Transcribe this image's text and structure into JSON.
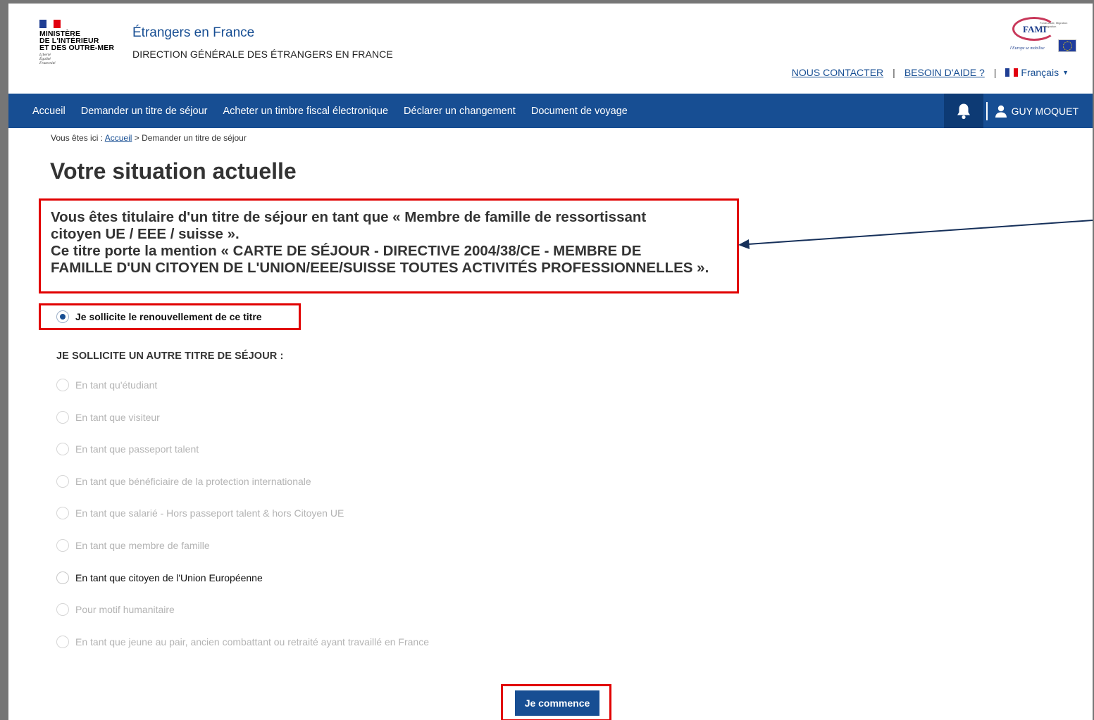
{
  "header": {
    "ministry_lines": [
      "MINISTÈRE",
      "DE L'INTÉRIEUR",
      "ET DES OUTRE-MER"
    ],
    "devise_lines": [
      "Liberté",
      "Égalité",
      "Fraternité"
    ],
    "site_title": "Étrangers en France",
    "site_subtitle": "DIRECTION GÉNÉRALE DES ÉTRANGERS EN FRANCE",
    "fami_logo_text": "FAMI",
    "fami_caption": "Fonds Asile, Migration et Intégration",
    "fami_eu_text": "l'Europe se mobilise",
    "links": {
      "contact": "NOUS CONTACTER",
      "help": "BESOIN D'AIDE ?",
      "separator": "|"
    },
    "language": "Français"
  },
  "nav": {
    "items": [
      "Accueil",
      "Demander un titre de séjour",
      "Acheter un timbre fiscal électronique",
      "Déclarer un changement",
      "Document de voyage"
    ],
    "user_name": "GUY MOQUET"
  },
  "breadcrumb": {
    "prefix": "Vous êtes ici :",
    "home": "Accueil",
    "current": "> Demander un titre de séjour"
  },
  "page_title": "Votre situation actuelle",
  "situation": {
    "line1": "Vous êtes titulaire d'un titre de séjour en tant que « Membre de famille de ressortissant",
    "line2": "citoyen UE / EEE / suisse ».",
    "line3": "Ce titre porte la mention « CARTE DE SÉJOUR - DIRECTIVE 2004/38/CE - MEMBRE DE",
    "line4": "FAMILLE D'UN CITOYEN DE L'UNION/EEE/SUISSE TOUTES ACTIVITÉS PROFESSIONNELLES »."
  },
  "renewal_option": "Je sollicite le renouvellement de ce titre",
  "other_section_title": "JE SOLLICITE UN AUTRE TITRE DE SÉJOUR :",
  "other_options": [
    "En tant qu'étudiant",
    "En tant que visiteur",
    "En tant que passeport talent",
    "En tant que bénéficiaire de la protection internationale",
    "En tant que salarié - Hors passeport talent & hors Citoyen UE",
    "En tant que membre de famille",
    "En tant que citoyen de l'Union Européenne",
    "Pour motif humanitaire",
    "En tant que jeune au pair, ancien combattant ou retraité ayant travaillé en France"
  ],
  "start_button": "Je commence",
  "colors": {
    "brand_blue": "#174e93",
    "annotation_red": "#e10000",
    "disabled_text": "#b4b4b4"
  }
}
